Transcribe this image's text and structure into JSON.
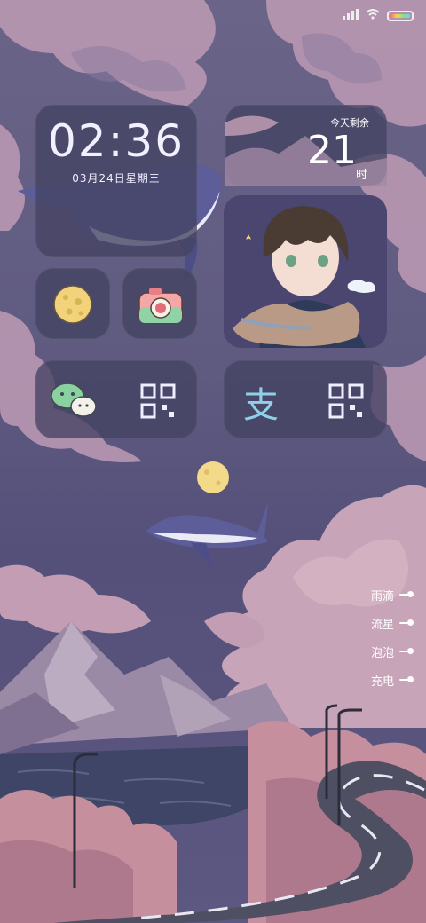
{
  "status_bar": {
    "signal_icon": "signal-icon",
    "wifi_icon": "wifi-icon",
    "battery_icon": "battery-icon"
  },
  "clock_widget": {
    "time": "02:36",
    "date": "03月24日星期三"
  },
  "day_widget": {
    "label": "今天剩余",
    "hours": "21",
    "unit": "时"
  },
  "apps": {
    "moon": {
      "icon": "moon-icon"
    },
    "camera": {
      "icon": "camera-icon"
    },
    "wechat": {
      "icon": "wechat-icon",
      "qr_icon": "qr-code-icon"
    },
    "alipay": {
      "glyph": "支",
      "qr_icon": "qr-code-icon"
    }
  },
  "effects": [
    {
      "label": "雨滴"
    },
    {
      "label": "流星"
    },
    {
      "label": "泡泡"
    },
    {
      "label": "充电"
    }
  ],
  "colors": {
    "tile_bg": "#444262",
    "text": "#f2f0ff",
    "cloud": "#c6a2b8",
    "road": "#4e4f62"
  }
}
